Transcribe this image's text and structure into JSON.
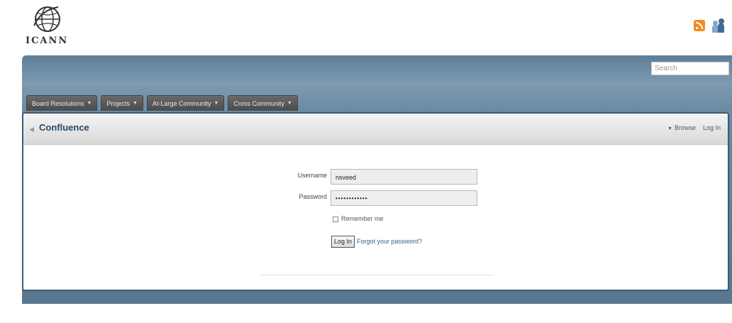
{
  "brand": {
    "wordmark": "ICANN"
  },
  "header": {
    "search_placeholder": "Search",
    "icons": [
      "rss-icon",
      "people-icon"
    ]
  },
  "nav": {
    "tabs": [
      {
        "label": "Board Resolutions"
      },
      {
        "label": "Projects"
      },
      {
        "label": "At-Large Community"
      },
      {
        "label": "Cross Community"
      }
    ]
  },
  "panel": {
    "title": "Confluence",
    "browse_label": "Browse",
    "login_link": "Log In"
  },
  "login_form": {
    "username_label": "Username",
    "username_value": "nsveed",
    "password_label": "Password",
    "password_value": "••••••••••••",
    "remember_label": "Remember me",
    "remember_checked": false,
    "submit_label": "Log In",
    "forgot_label": "Forgot your password?"
  },
  "colors": {
    "band": "#6a8aa2",
    "nav_tab": "#545454",
    "title": "#2a4a6a",
    "rss": "#f08a24"
  }
}
